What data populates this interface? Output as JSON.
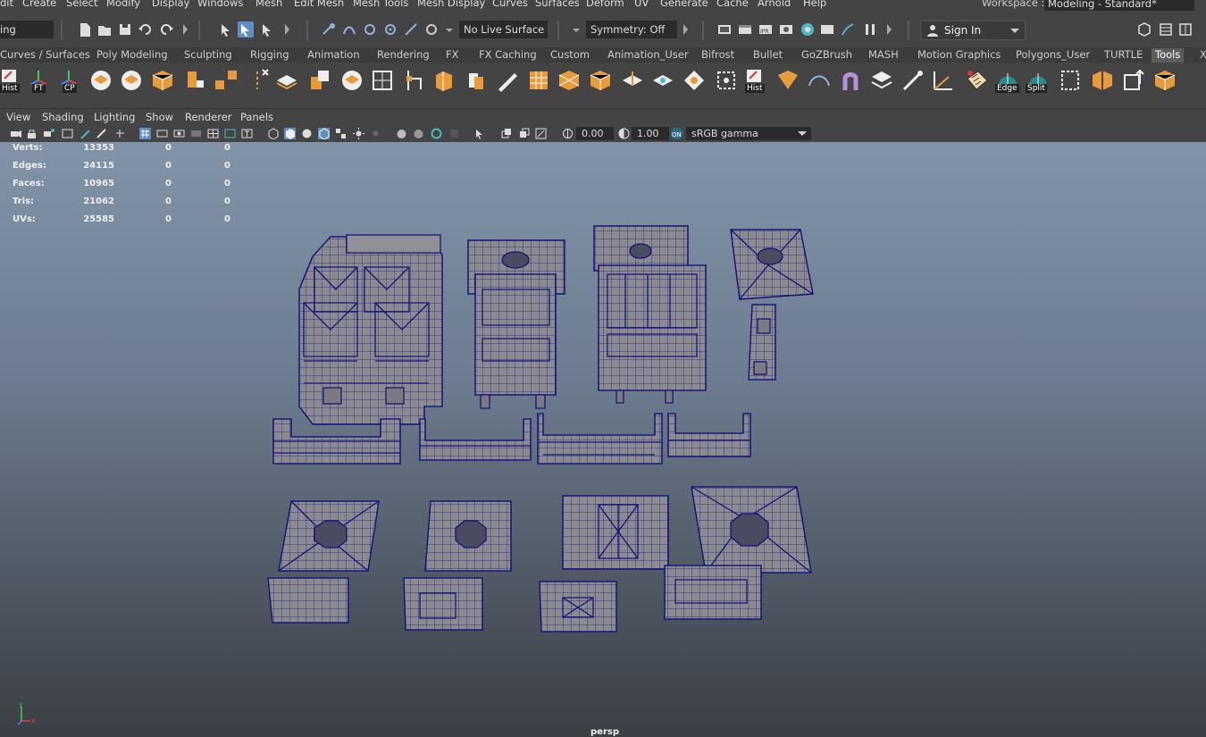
{
  "menubar": {
    "items": [
      "dit",
      "Create",
      "Select",
      "Modify",
      "Display",
      "Windows",
      "Mesh",
      "Edit Mesh",
      "Mesh Tools",
      "Mesh Display",
      "Curves",
      "Surfaces",
      "Deform",
      "UV",
      "Generate",
      "Cache",
      "Arnold",
      "Help"
    ],
    "workspace_label": "Workspace :",
    "workspace_value": "Modeling - Standard*"
  },
  "statusline": {
    "mode_value": "ing",
    "live_surface": "No Live Surface",
    "symmetry": "Symmetry: Off",
    "sign_in": "Sign In"
  },
  "shelf": {
    "tabs": [
      "Curves / Surfaces",
      "Poly Modeling",
      "Sculpting",
      "Rigging",
      "Animation",
      "Rendering",
      "FX",
      "FX Caching",
      "Custom",
      "Animation_User",
      "Bifrost",
      "Bullet",
      "GoZBrush",
      "MASH",
      "Motion Graphics",
      "Polygons_User",
      "TURTLE",
      "Tools",
      "X"
    ],
    "active_tab": "Tools",
    "labels": {
      "hist": "Hist",
      "ft": "FT",
      "cp": "CP",
      "hist2": "Hist",
      "edge": "Edge",
      "split": "Split"
    }
  },
  "panel": {
    "menus": [
      "View",
      "Shading",
      "Lighting",
      "Show",
      "Renderer",
      "Panels"
    ],
    "exposure": "0.00",
    "gamma": "1.00",
    "color_space": "sRGB gamma"
  },
  "hud": {
    "rows": [
      {
        "label": "Verts:",
        "v1": "13353",
        "v2": "0",
        "v3": "0"
      },
      {
        "label": "Edges:",
        "v1": "24115",
        "v2": "0",
        "v3": "0"
      },
      {
        "label": "Faces:",
        "v1": "10965",
        "v2": "0",
        "v3": "0"
      },
      {
        "label": "Tris:",
        "v1": "21062",
        "v2": "0",
        "v3": "0"
      },
      {
        "label": "UVs:",
        "v1": "25585",
        "v2": "0",
        "v3": "0"
      }
    ],
    "camera": "persp"
  },
  "colors": {
    "accent": "#5d9bd4",
    "wire": "#14147a",
    "mesh_fill": "#8a8a90",
    "ui_bg": "#444444"
  }
}
